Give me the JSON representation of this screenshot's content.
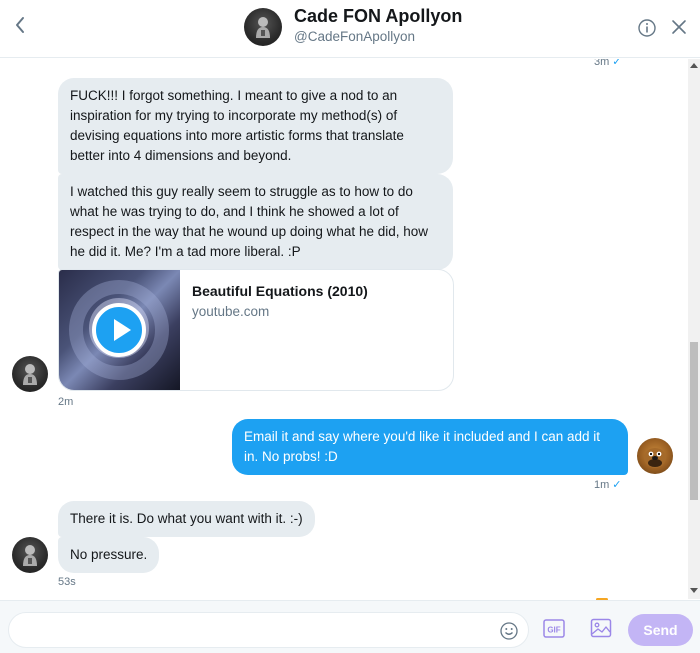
{
  "header": {
    "name": "Cade FON Apollyon",
    "handle": "@CadeFonApollyon",
    "back_icon": "chevron-left-icon",
    "info_icon": "info-icon",
    "close_icon": "close-icon"
  },
  "messages": {
    "top_time": "3m",
    "m1": "FUCK!!! I forgot something. I meant to give a nod to an inspiration for my trying to incorporate my method(s) of devising equations into more artistic forms that translate better into 4 dimensions and beyond.",
    "m2": "I watched this guy really seem to struggle as to how to do what he was trying to do, and I think he showed a lot of respect in the way that he wound up doing what he did, how he did it. Me? I'm a tad more liberal. :P",
    "card": {
      "title": "Beautiful Equations (2010)",
      "domain": "youtube.com"
    },
    "time1": "2m",
    "m_out": "Email it and say where you'd like it included and I can add it in. No probs! :D",
    "time2": "1m",
    "m3": "There it is. Do what you want with it. :-)",
    "m4": "No pressure.",
    "time3": "53s"
  },
  "composer": {
    "placeholder": "",
    "send_label": "Send",
    "emoji_icon": "emoji-icon",
    "gif_label": "GIF",
    "image_icon": "image-icon"
  },
  "colors": {
    "accent": "#1da1f2",
    "incoming_bubble": "#e6ecf0",
    "send_disabled": "#c3b5f5",
    "secondary_text": "#657786"
  }
}
